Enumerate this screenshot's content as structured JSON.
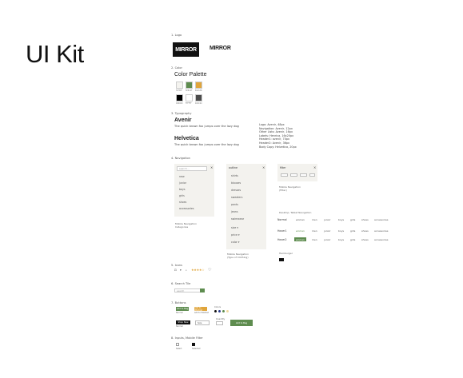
{
  "page": {
    "title": "UI Kit"
  },
  "sections": {
    "logo": "1. Logo",
    "color": "2. Color",
    "typography": "3. Typography",
    "navigation": "4. Navigation",
    "icons": "5. Icons",
    "search": "6. Search Tile",
    "buttons": "7. Buttons",
    "inputs": "8. Inputs, Mobile Filter"
  },
  "logo": {
    "black_text": "MIRROR",
    "white_text": "MIRROR"
  },
  "palette": {
    "title": "Color Palette",
    "swatches": [
      {
        "color": "#f4f3ef",
        "label": "F4F3EF"
      },
      {
        "color": "#5e8c4f",
        "label": "5E8C4F"
      },
      {
        "color": "#e0a53b",
        "label": "E0A53B"
      },
      {
        "color": "#000000",
        "label": "000000"
      },
      {
        "color": "#ffffff",
        "label": "FFFFFF"
      },
      {
        "color": "#4c4c4c",
        "label": "4C4C4C"
      }
    ]
  },
  "typography": {
    "avenir_head": "Avenir",
    "avenir_body": "The quick brown fox jumps over the lazy dog",
    "helvetica_head": "Helvetica",
    "helvetica_body": "The quick brown fox jumps over the lazy dog",
    "specs": [
      "Logo: Avenir, 48px",
      "Navigation: Avenir, 12px",
      "Other Lists: Avenir, 16px",
      "Labels: Henrica, 16x20px",
      "Header1: avenir, 70px",
      "Header2: Avenir, 36px",
      "Body Copy: Helvetica, 20px"
    ]
  },
  "mobile_nav": {
    "search_placeholder": "search...",
    "items": [
      "new",
      "junior",
      "boys",
      "girls",
      "shoes",
      "accessories"
    ],
    "caption_1": "Mobile Navigation",
    "caption_2": "Categories"
  },
  "mobile_clothing": {
    "header": "outline",
    "items": [
      "shirts",
      "blouses",
      "dresses",
      "sweaters",
      "pants",
      "jeans",
      "swimwear"
    ],
    "filters": [
      "size ▾",
      "price ▾",
      "color ▾"
    ],
    "caption_1": "Mobile Navigation",
    "caption_2": "(Type of Clothing)"
  },
  "mobile_filter": {
    "header": "filter",
    "caption_1": "Mobile Navigation",
    "caption_2": "(Filter)"
  },
  "desktop_nav": {
    "title": "Desktop, Tablet Navigation",
    "states": [
      "Normal",
      "Hover1",
      "Hover2"
    ],
    "items": [
      "women",
      "men",
      "junior",
      "boys",
      "girls",
      "shoes",
      "accessories"
    ],
    "hamburger_label": "Hamburger"
  },
  "icons": {
    "rating_text": "★★★★☆"
  },
  "search_tile": {
    "placeholder": "search"
  },
  "buttons": {
    "green_label": "Add to Bag",
    "gold_label": "Add to Wishlist",
    "black_label": "Shop Now",
    "select_label": "Size",
    "colors_label": "Colors",
    "quantity_label": "Quantity",
    "green_cap": "Normal",
    "gold_cap": "Add to Wishlist",
    "black_cap": "Normal",
    "add_bag_big": "Add to Bag"
  },
  "inputs": {
    "checkbox_a": "Select",
    "checkbox_b": "Selected"
  }
}
